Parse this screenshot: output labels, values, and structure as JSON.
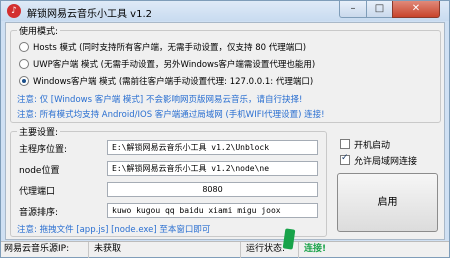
{
  "window": {
    "title": "解锁网易云音乐小工具 v1.2",
    "minimize_symbol": "–",
    "maximize_symbol": "□",
    "close_symbol": "✕"
  },
  "mode_group": {
    "title": "使用模式:",
    "options": [
      {
        "label": "Hosts 模式 (同时支持所有客户端，无需手动设置，仅支持 80 代理端口)",
        "checked": false
      },
      {
        "label": "UWP客户端 模式 (无需手动设置，另外Windows客户端需设置代理也能用)",
        "checked": false
      },
      {
        "label": "Windows客户端 模式 (需前往客户端手动设置代理: 127.0.0.1: 代理端口)",
        "checked": true
      }
    ],
    "notice_1": "注意: 仅 [Windows 客户端 模式] 不会影响网页版网易云音乐，请自行抉择!",
    "notice_2": "注意: 所有模式均支持 Android/IOS 客户端通过局域网 (手机WIFI代理设置) 连接!"
  },
  "main_settings": {
    "title": "主要设置:",
    "fields": [
      {
        "label": "主程序位置:",
        "value": "E:\\解锁网易云音乐小工具 v1.2\\Unblock"
      },
      {
        "label": "node位置",
        "value": "E:\\解锁网易云音乐小工具 v1.2\\node\\ne"
      },
      {
        "label": "代理端口",
        "value": "8080"
      },
      {
        "label": "音源排序:",
        "value": "kuwo kugou qq baidu xiami migu joox"
      }
    ],
    "notice": "注意: 拖拽文件 [app.js] [node.exe] 至本窗口即可"
  },
  "options": {
    "autostart_label": "开机启动",
    "autostart_checked": false,
    "lan_label": "允许局域网连接",
    "lan_checked": true
  },
  "start_button_label": "启用",
  "statusbar": {
    "source_ip_label": "网易云音乐源IP:",
    "source_ip_value": "未获取",
    "state_label": "运行状态:",
    "state_value": "连接!"
  },
  "colors": {
    "notice_blue": "#2a6fd1",
    "status_green": "#1aa34a",
    "title_bar": "#cfe0f3"
  },
  "icons": {
    "app_icon": "netease-music-icon"
  }
}
